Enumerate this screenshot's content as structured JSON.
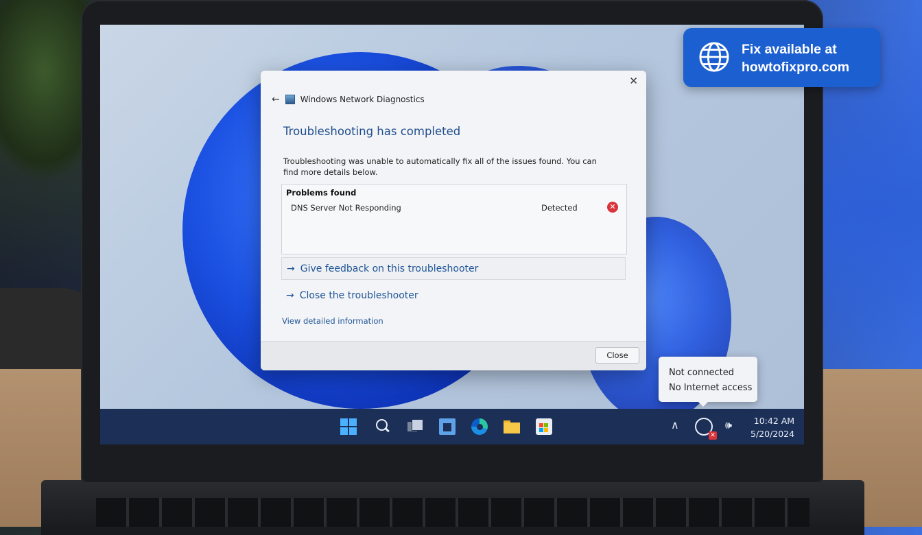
{
  "dialog": {
    "window_title": "Windows Network Diagnostics",
    "heading": "Troubleshooting has completed",
    "message": "Troubleshooting was unable to automatically fix all of the issues found. You can find more details below.",
    "problems_header": "Problems found",
    "problems": [
      {
        "name": "DNS Server Not Responding",
        "status": "Detected",
        "icon": "error-icon"
      }
    ],
    "link_feedback": "Give feedback on this troubleshooter",
    "link_close": "Close the troubleshooter",
    "link_details": "View detailed information",
    "close_button": "Close"
  },
  "tooltip": {
    "line1": "Not connected",
    "line2": "No Internet access"
  },
  "taskbar": {
    "icons": [
      "start-icon",
      "search-icon",
      "task-view-icon",
      "app-icon",
      "edge-icon",
      "file-explorer-icon",
      "store-icon"
    ],
    "time": "10:42 AM",
    "date": "5/20/2024"
  },
  "promo": {
    "line1": "Fix available at",
    "line2": "howtofixpro.com"
  },
  "colors": {
    "accent": "#1f5596",
    "error": "#d9343a",
    "promo_bg": "#1c5fd0",
    "taskbar_bg": "#1c2f57"
  }
}
